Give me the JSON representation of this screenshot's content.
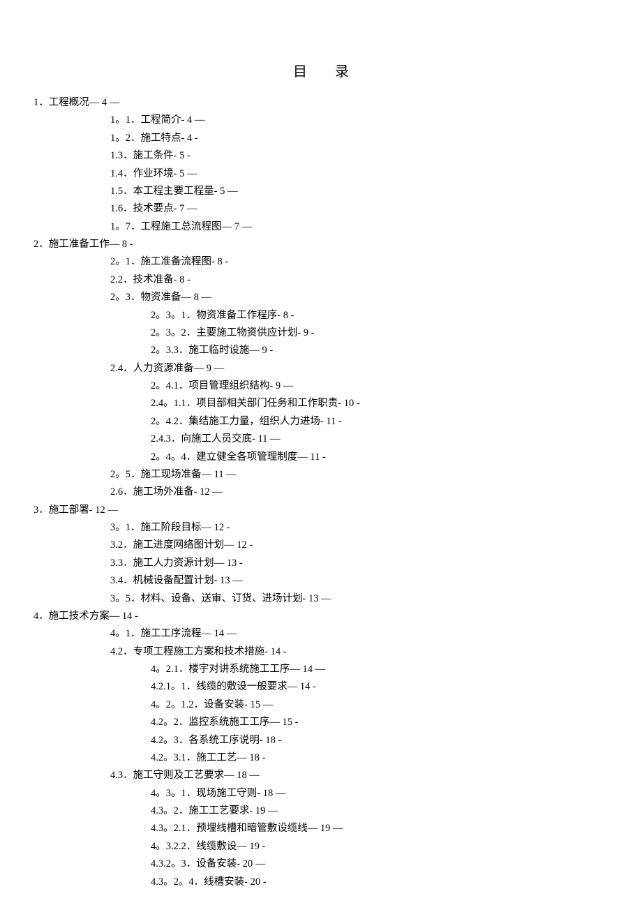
{
  "title": "目录",
  "entries": [
    {
      "level": 0,
      "text": "1．工程概况— 4 —"
    },
    {
      "level": 1,
      "text": "1。1．工程简介- 4 —"
    },
    {
      "level": 1,
      "text": "1。2．施工特点- 4 -"
    },
    {
      "level": 1,
      "text": "1.3．施工条件- 5 -"
    },
    {
      "level": 1,
      "text": "1.4．作业环境- 5 —"
    },
    {
      "level": 1,
      "text": "1.5．本工程主要工程量- 5 —"
    },
    {
      "level": 1,
      "text": "1.6．技术要点- 7 —"
    },
    {
      "level": 1,
      "text": "1。7．工程施工总流程图— 7 —"
    },
    {
      "level": 0,
      "text": "2．施工准备工作— 8 -"
    },
    {
      "level": 1,
      "text": "2。1．施工准备流程图- 8 -"
    },
    {
      "level": 1,
      "text": "2.2．技术准备- 8 -"
    },
    {
      "level": 1,
      "text": "2。3．物资准备— 8 —"
    },
    {
      "level": 2,
      "text": "2。3。1．物资准备工作程序- 8 -"
    },
    {
      "level": 2,
      "text": "2。3。2．主要施工物资供应计划- 9 -"
    },
    {
      "level": 2,
      "text": "2。3.3．施工临时设施— 9 -"
    },
    {
      "level": 1,
      "text": "2.4．人力资源准备— 9 —"
    },
    {
      "level": 2,
      "text": "2。4.1．项目管理组织结构- 9 —"
    },
    {
      "level": 2,
      "text": "2.4。1.1．项目部相关部门任务和工作职责- 10 -"
    },
    {
      "level": 2,
      "text": "2。4.2．集结施工力量，组织人力进场- 11 -"
    },
    {
      "level": 2,
      "text": "2.4.3．向施工人员交底- 11 —"
    },
    {
      "level": 2,
      "text": "2。4。4．建立健全各项管理制度— 11 -"
    },
    {
      "level": 1,
      "text": "2。5．施工现场准备— 11 —"
    },
    {
      "level": 1,
      "text": "2.6．施工场外准备- 12 —"
    },
    {
      "level": 0,
      "text": "3．施工部署- 12 —"
    },
    {
      "level": 1,
      "text": "3。1．施工阶段目标— 12 -"
    },
    {
      "level": 1,
      "text": "3.2．施工进度网络图计划— 12 -"
    },
    {
      "level": 1,
      "text": "3.3．施工人力资源计划— 13 -"
    },
    {
      "level": 1,
      "text": "3.4．机械设备配置计划- 13 —"
    },
    {
      "level": 1,
      "text": "3。5．材料、设备、送审、订货、进场计划- 13 —"
    },
    {
      "level": 0,
      "text": "4．施工技术方案— 14 -"
    },
    {
      "level": 1,
      "text": "4。1．施工工序流程— 14 —"
    },
    {
      "level": 1,
      "text": "4.2．专项工程施工方案和技术措施- 14 -"
    },
    {
      "level": 2,
      "text": "4。2.1．楼宇对讲系统施工工序— 14 —"
    },
    {
      "level": 2,
      "text": "4.2.1。1．线缆的敷设一般要求— 14 -"
    },
    {
      "level": 2,
      "text": "4。2。1.2．设备安装- 15 —"
    },
    {
      "level": 2,
      "text": "4.2。2．监控系统施工工序— 15 -"
    },
    {
      "level": 2,
      "text": "4.2。3．各系统工序说明- 18 -"
    },
    {
      "level": 2,
      "text": "4.2。3.1．施工工艺— 18 -"
    },
    {
      "level": 1,
      "text": "4.3．施工守则及工艺要求— 18 —"
    },
    {
      "level": 2,
      "text": "4。3。1．现场施工守则- 18 —"
    },
    {
      "level": 2,
      "text": "4.3。2．施工工艺要求- 19 —"
    },
    {
      "level": 2,
      "text": "4.3。2.1．预埋线槽和暗管敷设缆线— 19 —"
    },
    {
      "level": 2,
      "text": "4。3.2.2．线缆敷设— 19 -"
    },
    {
      "level": 2,
      "text": "4.3.2。3．设备安装- 20 —"
    },
    {
      "level": 2,
      "text": "4.3。2。4．线槽安装- 20 -"
    }
  ]
}
